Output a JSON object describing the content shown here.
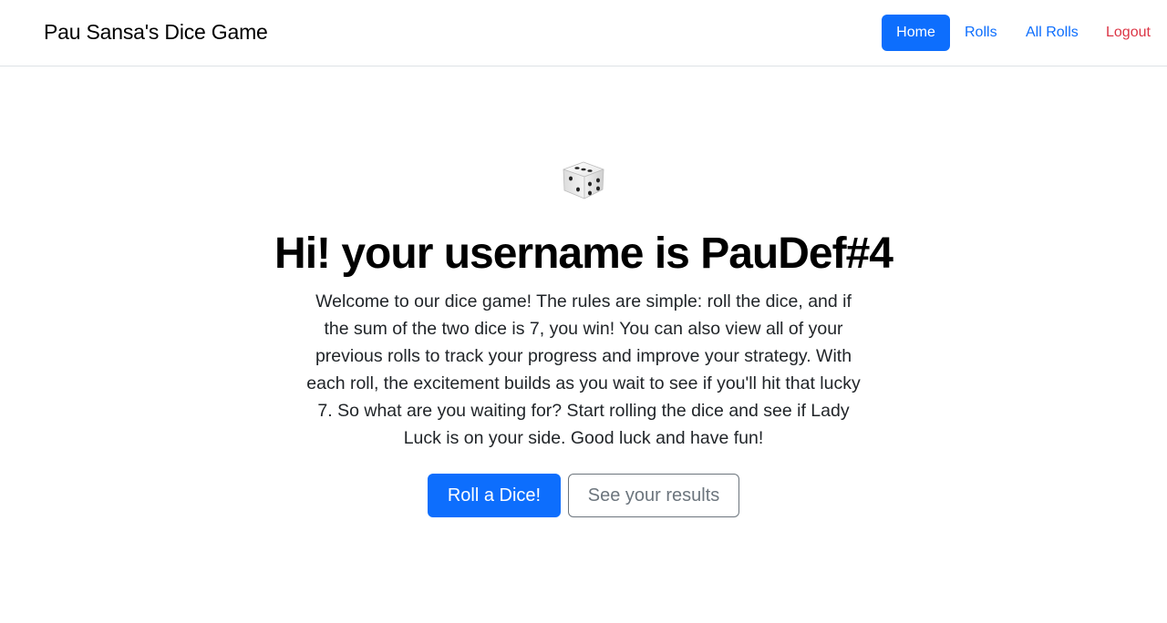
{
  "navbar": {
    "brand": "Pau Sansa's Dice Game",
    "links": [
      {
        "label": "Home",
        "active": true
      },
      {
        "label": "Rolls",
        "active": false
      },
      {
        "label": "All Rolls",
        "active": false
      },
      {
        "label": "Logout",
        "active": false
      }
    ]
  },
  "hero": {
    "icon": "dice-icon",
    "title": "Hi! your username is PauDef#4",
    "description": "Welcome to our dice game! The rules are simple: roll the dice, and if the sum of the two dice is 7, you win! You can also view all of your previous rolls to track your progress and improve your strategy. With each roll, the excitement builds as you wait to see if you'll hit that lucky 7. So what are you waiting for? Start rolling the dice and see if Lady Luck is on your side. Good luck and have fun!",
    "primary_button": "Roll a Dice!",
    "secondary_button": "See your results"
  },
  "colors": {
    "primary": "#0d6efd",
    "danger": "#dc3545",
    "secondary": "#6c757d"
  }
}
